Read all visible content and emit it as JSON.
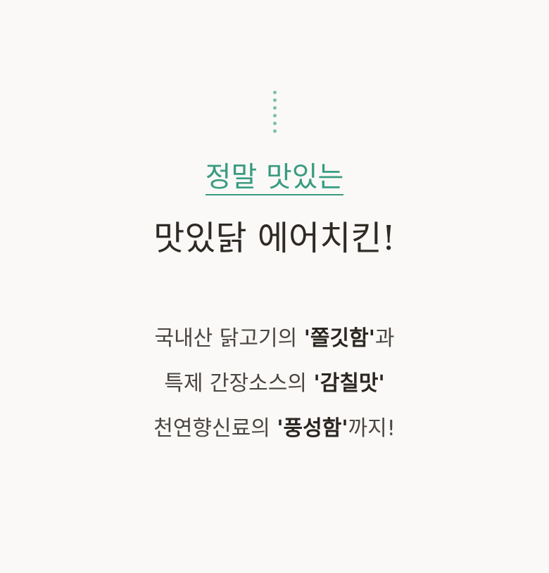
{
  "header": {
    "subtitle": "정말 맛있는",
    "title": "맛있닭 에어치킨!"
  },
  "description": [
    {
      "pre": "국내산 닭고기의 ",
      "emphasis": "'쫄깃함'",
      "post": "과"
    },
    {
      "pre": "특제 간장소스의 ",
      "emphasis": "'감칠맛'",
      "post": ""
    },
    {
      "pre": "천연향신료의 ",
      "emphasis": "'풍성함'",
      "post": "까지!"
    }
  ],
  "colors": {
    "background": "#faf9f8",
    "accent": "#3a9c80",
    "dots": "#7ac2a8",
    "title": "#2f2a24",
    "body": "#4a4540"
  }
}
